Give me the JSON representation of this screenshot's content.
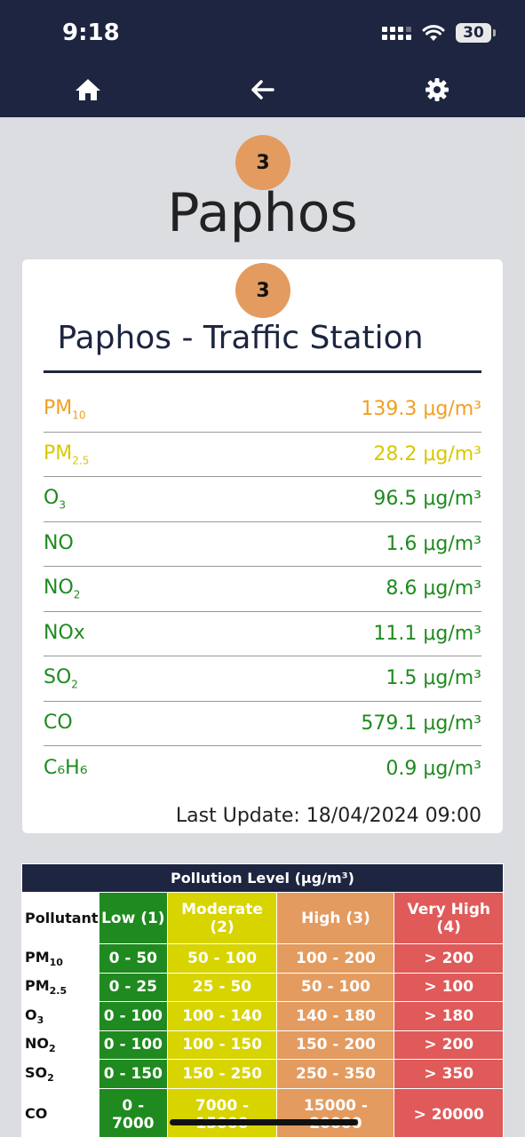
{
  "status_bar": {
    "time": "9:18",
    "battery": "30"
  },
  "colors": {
    "navbar": "#1d2540",
    "badge": "#e39b60",
    "low": "#1f8a1f",
    "moderate": "#d8d400",
    "high": "#e39b60",
    "very_high": "#e05a5a"
  },
  "icons": {
    "home": "home-icon",
    "back": "arrow-left-icon",
    "settings": "gear-icon"
  },
  "city": {
    "index": "3",
    "name": "Paphos"
  },
  "station": {
    "index": "3",
    "name": "Paphos - Traffic Station",
    "measurements": [
      {
        "base": "PM",
        "sub": "10",
        "value": "139.3 μg/m³",
        "level": "orange"
      },
      {
        "base": "PM",
        "sub": "2.5",
        "value": "28.2 μg/m³",
        "level": "yellow"
      },
      {
        "base": "O",
        "sub": "3",
        "value": "96.5 μg/m³",
        "level": "green"
      },
      {
        "base": "NO",
        "sub": "",
        "value": "1.6 μg/m³",
        "level": "green"
      },
      {
        "base": "NO",
        "sub": "2",
        "value": "8.6 μg/m³",
        "level": "green"
      },
      {
        "base": "NOx",
        "sub": "",
        "value": "11.1 μg/m³",
        "level": "green"
      },
      {
        "base": "SO",
        "sub": "2",
        "value": "1.5 μg/m³",
        "level": "green"
      },
      {
        "base": "CO",
        "sub": "",
        "value": "579.1 μg/m³",
        "level": "green"
      },
      {
        "base": "C₆H₆",
        "sub": "",
        "value": "0.9 μg/m³",
        "level": "green"
      }
    ],
    "last_update": "Last Update: 18/04/2024 09:00"
  },
  "levels_table": {
    "title": "Pollution Level (μg/m³)",
    "headers": [
      "Pollutant",
      "Low (1)",
      "Moderate (2)",
      "High (3)",
      "Very High (4)"
    ],
    "rows": [
      {
        "base": "PM",
        "sub": "10",
        "low": "0 - 50",
        "moderate": "50 - 100",
        "high": "100 - 200",
        "very_high": "> 200"
      },
      {
        "base": "PM",
        "sub": "2.5",
        "low": "0 - 25",
        "moderate": "25 - 50",
        "high": "50 - 100",
        "very_high": "> 100"
      },
      {
        "base": "O",
        "sub": "3",
        "low": "0 - 100",
        "moderate": "100 - 140",
        "high": "140 - 180",
        "very_high": "> 180"
      },
      {
        "base": "NO",
        "sub": "2",
        "low": "0 - 100",
        "moderate": "100 - 150",
        "high": "150 - 200",
        "very_high": "> 200"
      },
      {
        "base": "SO",
        "sub": "2",
        "low": "0 - 150",
        "moderate": "150 - 250",
        "high": "250 - 350",
        "very_high": "> 350"
      },
      {
        "base": "CO",
        "sub": "",
        "low": "0 - 7000",
        "moderate": "7000 - 15000",
        "high": "15000 - 20000",
        "very_high": "> 20000"
      }
    ]
  }
}
